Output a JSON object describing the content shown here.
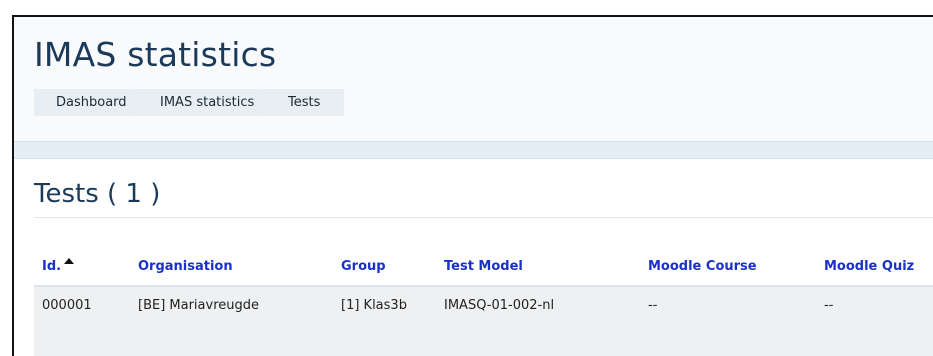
{
  "page": {
    "title": "IMAS statistics"
  },
  "breadcrumb": {
    "items": [
      "Dashboard",
      "IMAS statistics",
      "Tests"
    ]
  },
  "section": {
    "title": "Tests ( 1 )"
  },
  "table": {
    "columns": [
      "Id.",
      "Organisation",
      "Group",
      "Test Model",
      "Moodle Course",
      "Moodle Quiz"
    ],
    "sort": {
      "column": "Id.",
      "direction": "ascending"
    },
    "rows": [
      {
        "id": "000001",
        "organisation": "[BE] Mariavreugde",
        "group": "[1] Klas3b",
        "test_model": "IMASQ-01-002-nl",
        "moodle_course": "--",
        "moodle_quiz": "--"
      }
    ]
  },
  "colors": {
    "header_link": "#1a31c8",
    "title": "#1b3a5a",
    "row_background": "#eef0f2",
    "breadcrumb_background": "#e7eef4"
  },
  "icons": {
    "sort": "sort-ascending-icon"
  }
}
